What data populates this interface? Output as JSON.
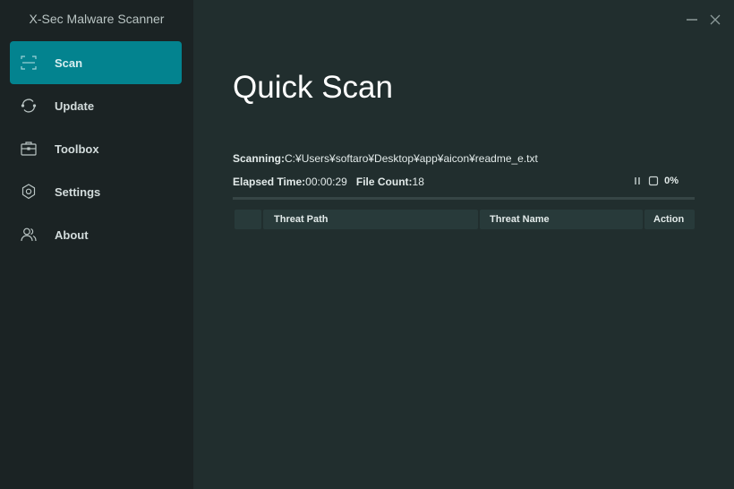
{
  "app": {
    "title": "X-Sec Malware Scanner",
    "accent_color": "#03838f"
  },
  "sidebar": {
    "items": [
      {
        "label": "Scan",
        "icon": "scan-icon",
        "active": true
      },
      {
        "label": "Update",
        "icon": "refresh-icon",
        "active": false
      },
      {
        "label": "Toolbox",
        "icon": "toolbox-icon",
        "active": false
      },
      {
        "label": "Settings",
        "icon": "gear-icon",
        "active": false
      },
      {
        "label": "About",
        "icon": "users-icon",
        "active": false
      }
    ]
  },
  "window": {
    "minimize_icon": "minimize-icon",
    "close_icon": "close-icon"
  },
  "main": {
    "title": "Quick Scan",
    "scanning_label": "Scanning:",
    "scanning_path": "C:¥Users¥softaro¥Desktop¥app¥aicon¥readme_e.txt",
    "elapsed_label": "Elapsed Time:",
    "elapsed_value": "00:00:29",
    "file_count_label": "File Count:",
    "file_count_value": "18",
    "progress_text": "0%",
    "progress_percent": 0,
    "pause_icon": "pause-icon",
    "stop_icon": "stop-icon",
    "table": {
      "columns": [
        "",
        "Threat Path",
        "Threat Name",
        "Action"
      ],
      "rows": []
    }
  }
}
